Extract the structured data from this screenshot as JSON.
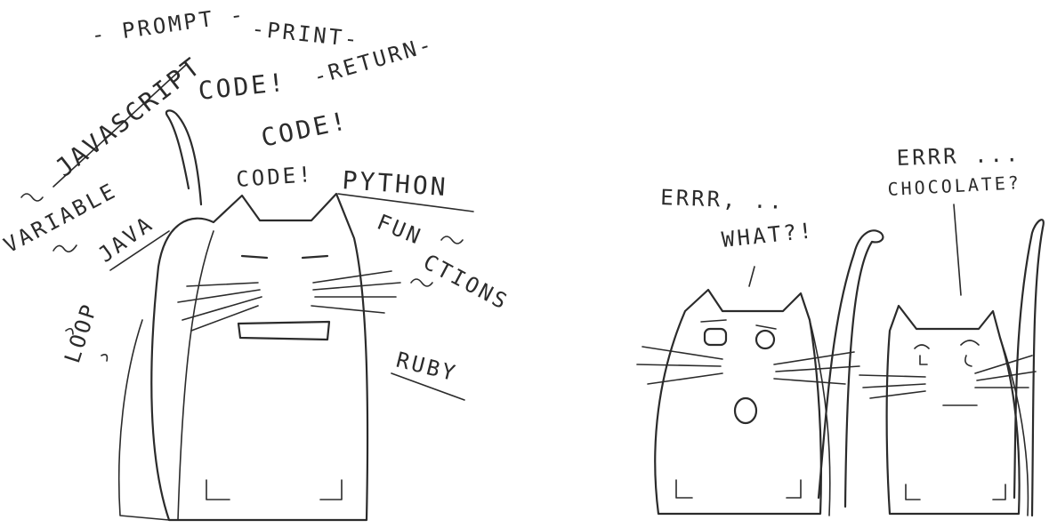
{
  "cat_words": {
    "prompt": "- PROMPT -",
    "print": "-PRINT-",
    "javascript": "JAVASCRIPT",
    "code1": "CODE!",
    "return": "-RETURN-",
    "code2": "CODE!",
    "code3": "CODE!",
    "python": "PYTHON",
    "variable": "VARIABLE",
    "java": "JAVA",
    "functions_fun": "FUN",
    "functions_ctions": "CTIONS",
    "loop": "LOOP",
    "ruby": "RUBY"
  },
  "dialogue": {
    "errr_left": "ERRR, ..",
    "what": "WHAT?!",
    "errr_right": "ERRR ...",
    "chocolate": "CHOCOLATE?"
  },
  "colors": {
    "ink": "#2b2b2b",
    "paper": "#ffffff"
  }
}
